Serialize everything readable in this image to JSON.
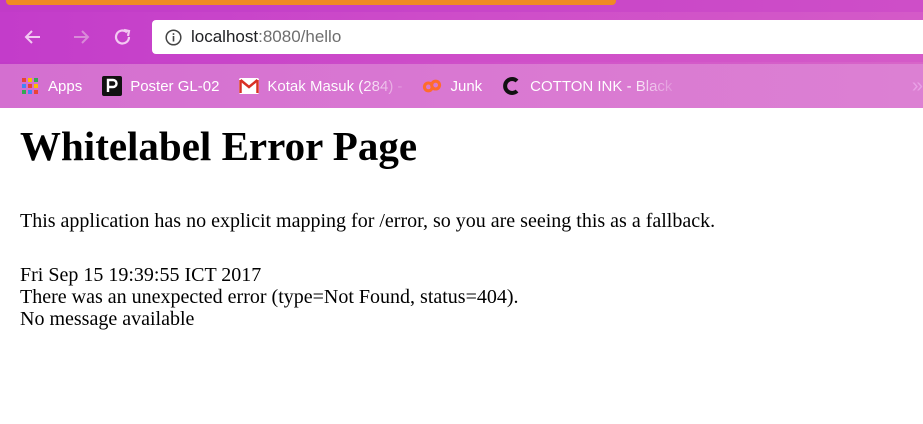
{
  "browser": {
    "address_bar": {
      "host": "localhost",
      "rest": ":8080/hello"
    },
    "bookmarks": [
      {
        "label": "Apps",
        "icon": "apps-grid-icon"
      },
      {
        "label": "Poster GL-02",
        "icon": "poster-p-icon"
      },
      {
        "label": "Kotak Masuk (284) - ",
        "icon": "gmail-icon"
      },
      {
        "label": "Junk",
        "icon": "cp-icon"
      },
      {
        "label": "COTTON INK - Black ",
        "icon": "c-icon"
      }
    ],
    "colors": {
      "toolbar": "#c33cca",
      "bookmarks_bar": "#d46fd0",
      "active_tab_accent": "#f08a24"
    }
  },
  "page": {
    "title": "Whitelabel Error Page",
    "description": "This application has no explicit mapping for /error, so you are seeing this as a fallback.",
    "timestamp": "Fri Sep 15 19:39:55 ICT 2017",
    "error_line": "There was an unexpected error (type=Not Found, status=404).",
    "message": "No message available"
  }
}
